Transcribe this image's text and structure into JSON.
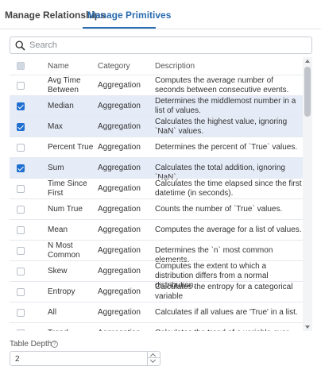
{
  "tabs": {
    "manage_relationships": "Manage Relationships",
    "manage_primitives": "Manage Primitives",
    "active": "Manage Primitives"
  },
  "search": {
    "placeholder": "Search",
    "value": ""
  },
  "table": {
    "headers": {
      "name": "Name",
      "category": "Category",
      "description": "Description"
    },
    "rows": [
      {
        "name": "Avg Time Between",
        "category": "Aggregation",
        "description": "Computes the average number of seconds between consecutive events.",
        "checked": false
      },
      {
        "name": "Median",
        "category": "Aggregation",
        "description": "Determines the middlemost number in a list of values.",
        "checked": true
      },
      {
        "name": "Max",
        "category": "Aggregation",
        "description": "Calculates the highest value, ignoring `NaN` values.",
        "checked": true
      },
      {
        "name": "Percent True",
        "category": "Aggregation",
        "description": "Determines the percent of `True` values.",
        "checked": false
      },
      {
        "name": "Sum",
        "category": "Aggregation",
        "description": "Calculates the total addition, ignoring `NaN`.",
        "checked": true
      },
      {
        "name": "Time Since First",
        "category": "Aggregation",
        "description": "Calculates the time elapsed since the first datetime (in seconds).",
        "checked": false
      },
      {
        "name": "Num True",
        "category": "Aggregation",
        "description": "Counts the number of `True` values.",
        "checked": false
      },
      {
        "name": "Mean",
        "category": "Aggregation",
        "description": "Computes the average for a list of values.",
        "checked": false
      },
      {
        "name": "N Most Common",
        "category": "Aggregation",
        "description": "Determines the `n` most common elements.",
        "checked": false
      },
      {
        "name": "Skew",
        "category": "Aggregation",
        "description": "Computes the extent to which a distribution differs from a normal distribution.",
        "checked": false
      },
      {
        "name": "Entropy",
        "category": "Aggregation",
        "description": "Calculates the entropy for a categorical variable",
        "checked": false
      },
      {
        "name": "All",
        "category": "Aggregation",
        "description": "Calculates if all values are 'True' in a list.",
        "checked": false
      },
      {
        "name": "Trend",
        "category": "Aggregation",
        "description": "Calculates the trend of a variable over time.",
        "checked": false
      }
    ]
  },
  "table_depth": {
    "label": "Table Depth",
    "value": "2"
  },
  "colors": {
    "accent": "#2b6cb0",
    "checkbox": "#1f6fd1",
    "selected_row": "#e6ecf7"
  }
}
